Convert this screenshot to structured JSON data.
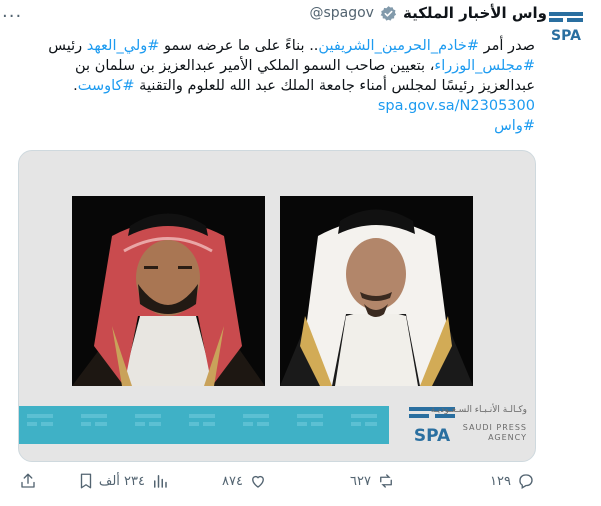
{
  "author": {
    "display_name": "واس الأخبار الملكية",
    "handle": "@spagov",
    "avatar_text": "SPA"
  },
  "more_label": "···",
  "tweet": {
    "segments_line1": [
      {
        "t": "صدر أمر ",
        "tag": false
      },
      {
        "t": "#خادم_الحرمين_الشريفين",
        "tag": true
      },
      {
        "t": ".. بناءً على ما عرضه سمو ",
        "tag": false
      },
      {
        "t": "#ولي_العهد",
        "tag": true
      },
      {
        "t": " رئيس",
        "tag": false
      }
    ],
    "segments_line2": [
      {
        "t": "#مجلس_الوزراء",
        "tag": true
      },
      {
        "t": "، بتعيين صاحب السمو الملكي الأمير عبدالعزيز بن سلمان بن",
        "tag": false
      }
    ],
    "segments_line3": [
      {
        "t": "عبدالعزيز رئيسًا لمجلس أمناء جامعة الملك عبد الله للعلوم والتقنية ",
        "tag": false
      },
      {
        "t": "#كاوست",
        "tag": true
      },
      {
        "t": ".",
        "tag": false
      }
    ],
    "link": "spa.gov.sa/N2305300",
    "hashtag_footer": "#واس"
  },
  "media": {
    "agency_ar": "وكـالـة الأنـبـاء السـعـوديـة",
    "agency_en_1": "SAUDI PRESS",
    "agency_en_2": "AGENCY",
    "mark_letters": "SPA"
  },
  "actions": {
    "replies": "١٢٩",
    "retweets": "٦٢٧",
    "likes": "٨٧٤",
    "views": "٢٣٤ ألف"
  },
  "colors": {
    "accent": "#1d9bf0",
    "muted": "#536471",
    "banner": "#3fb1c6",
    "spa_blue": "#2a6fa0"
  }
}
